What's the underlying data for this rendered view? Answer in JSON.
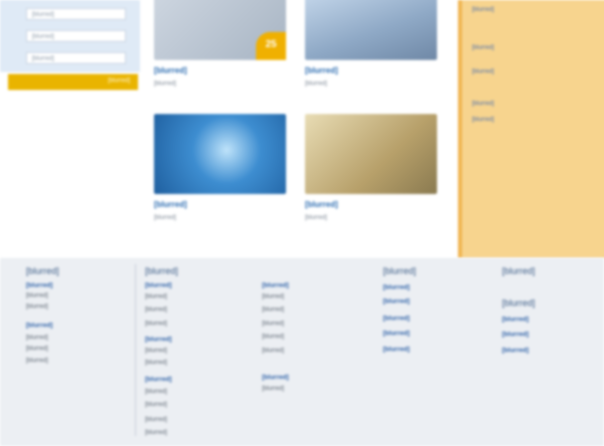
{
  "login": {
    "field1": "[blurred]",
    "field2": "[blurred]",
    "field3": "[blurred]",
    "submit": "[blurred]"
  },
  "tiles": [
    {
      "title": "[blurred]",
      "subtitle": "[blurred]",
      "badge": "25"
    },
    {
      "title": "[blurred]",
      "subtitle": "[blurred]"
    },
    {
      "title": "[blurred]",
      "subtitle": "[blurred]"
    },
    {
      "title": "[blurred]",
      "subtitle": "[blurred]"
    }
  ],
  "sidebar": {
    "links": [
      "[blurred]",
      "[blurred]",
      "[blurred]",
      "[blurred]",
      "[blurred]"
    ]
  },
  "footer": {
    "online": {
      "heading": "[blurred]",
      "sections": [
        {
          "title": "[blurred]",
          "items": [
            "[blurred]",
            "[blurred]"
          ]
        },
        {
          "title": "[blurred]",
          "items": [
            "[blurred]",
            "[blurred]",
            "[blurred]"
          ]
        }
      ]
    },
    "angebote": {
      "heading": "[blurred]",
      "col1": [
        {
          "title": "[blurred]",
          "items": [
            "[blurred]",
            "[blurred]",
            "[blurred]"
          ]
        },
        {
          "title": "[blurred]",
          "items": [
            "[blurred]",
            "[blurred]"
          ]
        },
        {
          "title": "[blurred]",
          "items": [
            "[blurred]",
            "[blurred]",
            "[blurred]",
            "[blurred]"
          ]
        }
      ],
      "col2": [
        {
          "title": "[blurred]",
          "items": [
            "[blurred]",
            "[blurred]",
            "[blurred]",
            "[blurred]",
            "[blurred]"
          ]
        },
        {
          "title": "[blurred]",
          "items": [
            "[blurred]"
          ]
        }
      ]
    },
    "unternehmen": {
      "heading": "[blurred]",
      "items": [
        "[blurred]",
        "[blurred]",
        "[blurred]",
        "[blurred]",
        "[blurred]"
      ]
    },
    "my": {
      "heading": "[blurred]",
      "impressum": "[blurred]",
      "items": [
        "[blurred]",
        "[blurred]",
        "[blurred]"
      ]
    }
  },
  "colors": {
    "accent": "#e9b400",
    "link": "#2a6bb0",
    "footer_bg": "#eceff3",
    "sidebar_bg": "#f7d48e"
  }
}
